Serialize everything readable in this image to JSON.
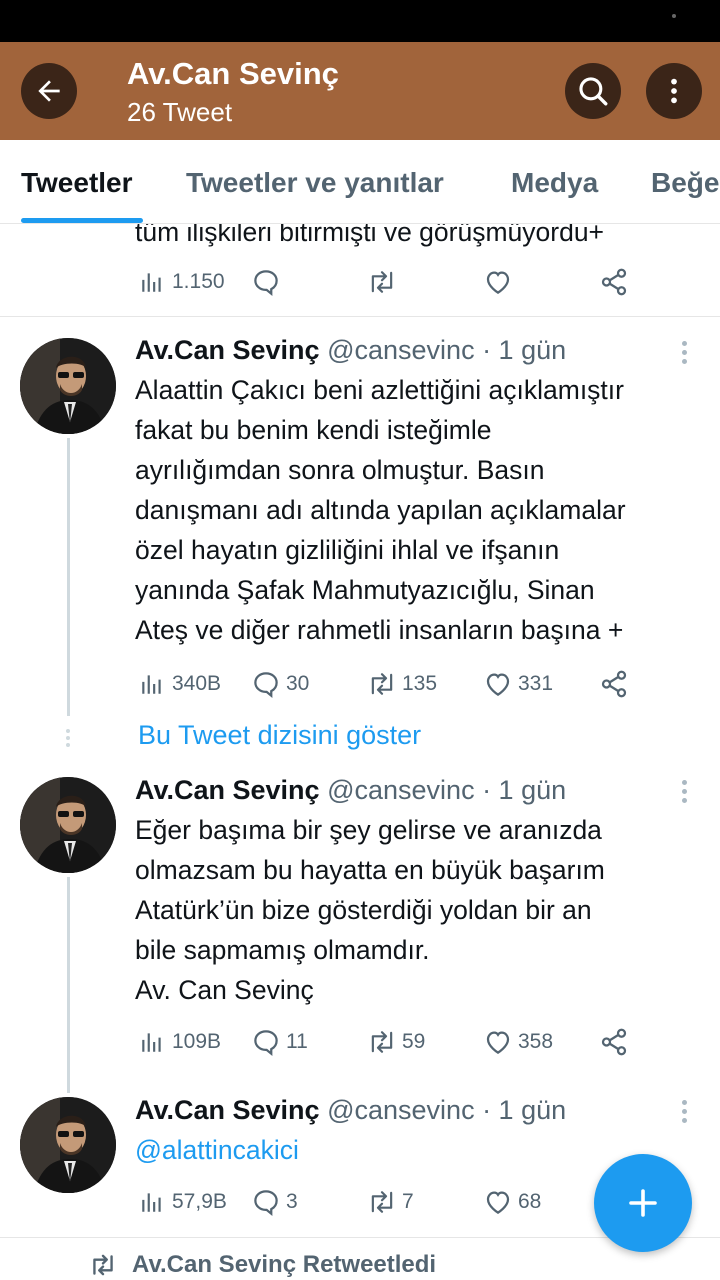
{
  "header": {
    "title": "Av.Can Sevinç",
    "subtitle": "26 Tweet"
  },
  "tabs": [
    {
      "label": "Tweetler",
      "active": true
    },
    {
      "label": "Tweetler ve yanıtlar",
      "active": false
    },
    {
      "label": "Medya",
      "active": false
    },
    {
      "label": "Beğeniler",
      "active": false
    }
  ],
  "first_tweet_partial": {
    "text_tail": "tüm ilişkileri bitirmişti ve görüşmüyordu+",
    "views": "1.150",
    "replies": "",
    "retweets": "",
    "likes": ""
  },
  "tweets": [
    {
      "name": "Av.Can Sevinç",
      "handle": "@cansevinc · 1 gün",
      "lines": [
        "Alaattin Çakıcı beni azlettiğini açıklamıştır",
        "fakat bu benim kendi isteğimle",
        "ayrılığımdan sonra olmuştur. Basın",
        "danışmanı adı altında yapılan açıklamalar",
        "özel hayatın gizliliğini ihlal ve ifşanın",
        "yanında Şafak Mahmutyazıcığlu, Sinan",
        "Ateş ve diğer rahmetli insanların başına +"
      ],
      "views": "340B",
      "replies": "30",
      "retweets": "135",
      "likes": "331"
    },
    {
      "name": "Av.Can Sevinç",
      "handle": "@cansevinc · 1 gün",
      "lines": [
        "Eğer başıma bir şey gelirse ve aranızda",
        "olmazsam bu hayatta en büyük başarım",
        "Atatürk’ün bize gösterdiği yoldan bir an",
        "bile sapmamış olmamdır.",
        "Av. Can Sevinç"
      ],
      "views": "109B",
      "replies": "11",
      "retweets": "59",
      "likes": "358"
    },
    {
      "name": "Av.Can Sevinç",
      "handle": "@cansevinc · 1 gün",
      "lines": [
        "@alattincakici"
      ],
      "views": "57,9B",
      "replies": "3",
      "retweets": "7",
      "likes": "68"
    }
  ],
  "show_thread_label": "Bu Tweet dizisini göster",
  "retweeted_label": "Av.Can Sevinç Retweetledi",
  "icons": {
    "back": "arrow-left-icon",
    "search": "search-icon",
    "more": "more-vertical-icon",
    "views": "analytics-icon",
    "reply": "reply-icon",
    "retweet": "retweet-icon",
    "like": "heart-icon",
    "share": "share-icon",
    "compose": "plus-icon"
  },
  "colors": {
    "appbar": "#a1643b",
    "appbar_button": "#3b2518",
    "accent": "#1d9bf0",
    "muted_text": "#536471"
  }
}
